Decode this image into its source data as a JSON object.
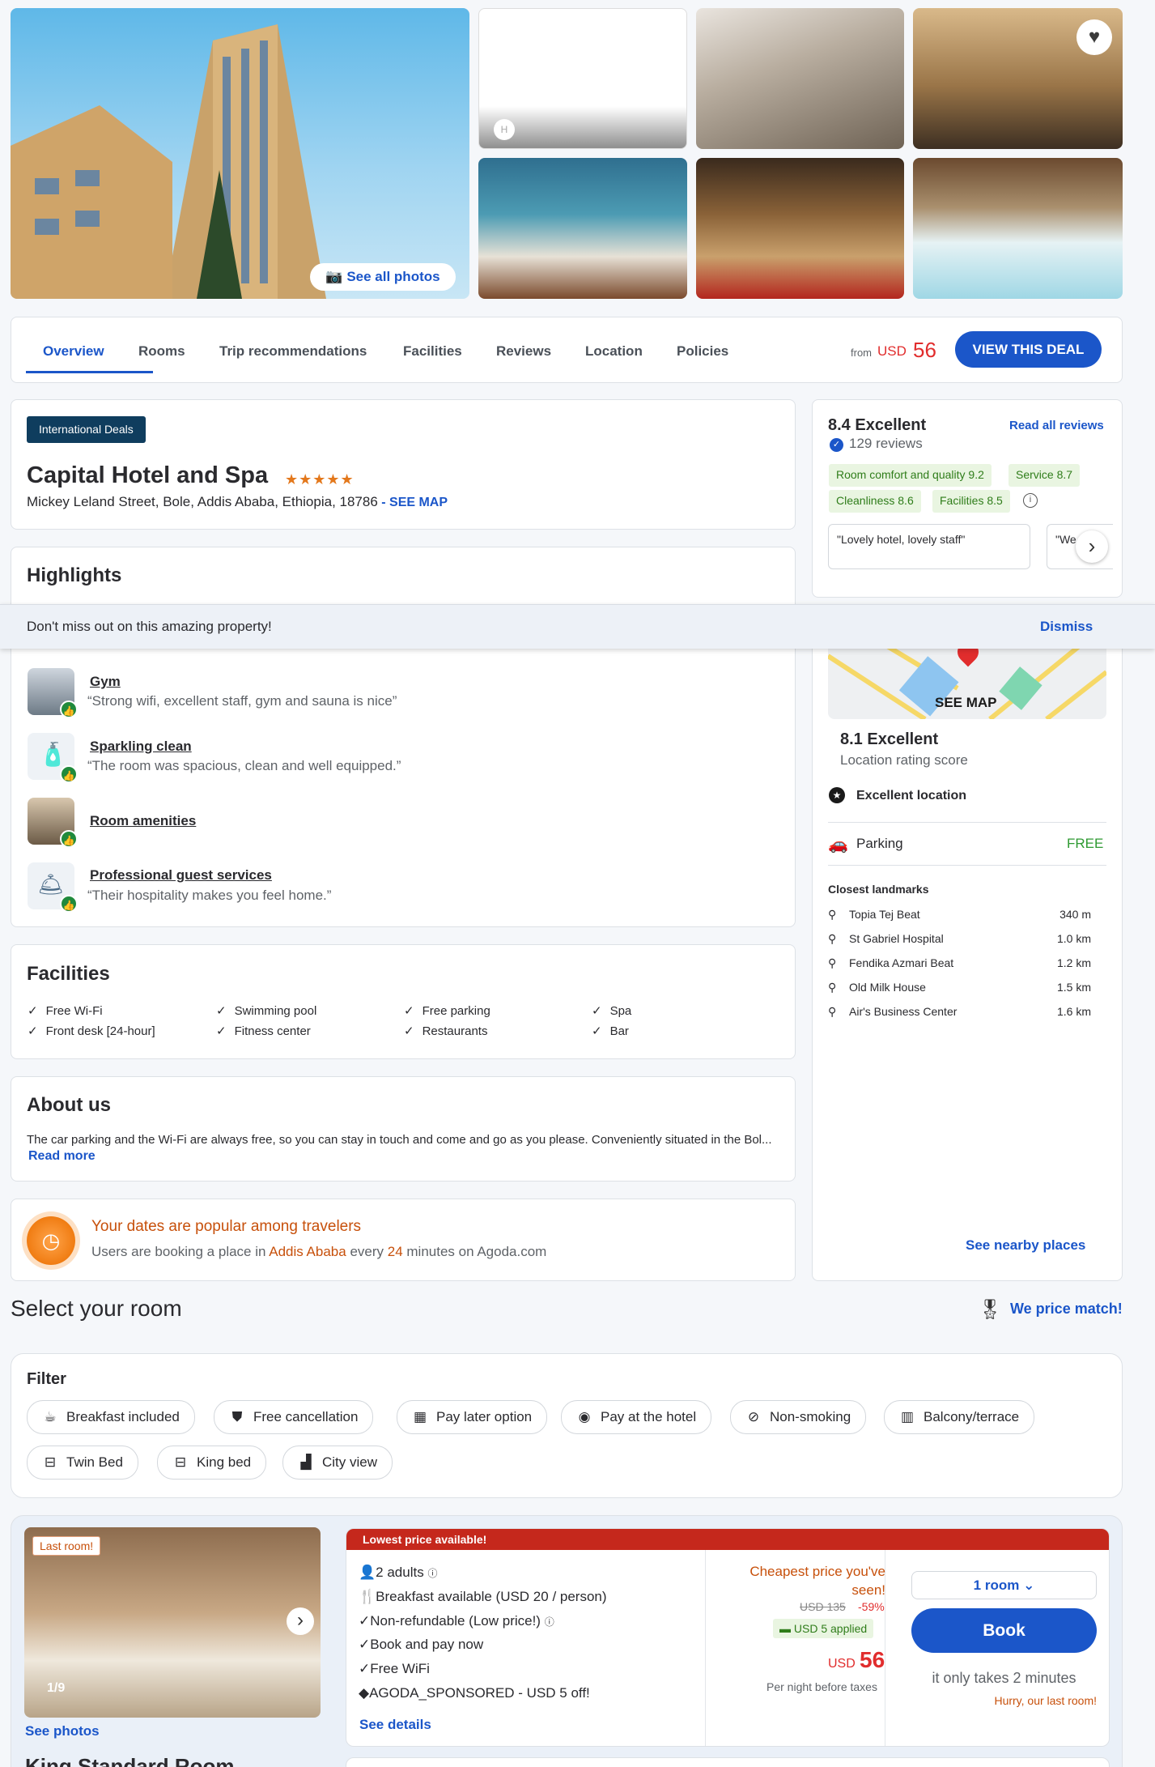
{
  "gallery": {
    "see_all_photos": "See all photos",
    "loading_badge": "H"
  },
  "nav": {
    "tabs": [
      "Overview",
      "Rooms",
      "Trip recommendations",
      "Facilities",
      "Reviews",
      "Location",
      "Policies"
    ],
    "from_label": "from",
    "currency": "USD",
    "price": "56",
    "cta": "VIEW THIS DEAL"
  },
  "hotel": {
    "badge": "International Deals",
    "name": "Capital Hotel and Spa",
    "stars": "★★★★★",
    "address": "Mickey Leland Street, Bole, Addis Ababa, Ethiopia, 18786",
    "see_map": " - SEE MAP"
  },
  "reviews": {
    "score": "8.4 Excellent",
    "count": "129 reviews",
    "read_all": "Read all reviews",
    "subscores": [
      "Room comfort and quality 9.2",
      "Service 8.7",
      "Cleanliness 8.6",
      "Facilities 8.5"
    ],
    "quote1": "\"Lovely hotel, lovely staff\"",
    "quote2": "\"We"
  },
  "highlights": {
    "title": "Highlights",
    "items": [
      {
        "title": "Gym",
        "quote": "“Strong wifi, excellent staff, gym and sauna is nice”"
      },
      {
        "title": "Sparkling clean",
        "quote": "“The room was spacious, clean and well equipped.”"
      },
      {
        "title": "Room amenities",
        "quote": ""
      },
      {
        "title": "Professional guest services",
        "quote": "“Their hospitality makes you feel home.”"
      }
    ]
  },
  "banner": {
    "text": "Don't miss out on this amazing property!",
    "dismiss": "Dismiss"
  },
  "location": {
    "see_map": "SEE MAP",
    "score": "8.1 Excellent",
    "score_label": "Location rating score",
    "excellent": "Excellent location",
    "parking": "Parking",
    "parking_value": "FREE",
    "landmarks_title": "Closest landmarks",
    "landmarks": [
      {
        "name": "Topia Tej Beat",
        "dist": "340 m",
        "icon": "⚲"
      },
      {
        "name": "St Gabriel Hospital",
        "dist": "1.0 km",
        "icon": "⚲"
      },
      {
        "name": "Fendika Azmari Beat",
        "dist": "1.2 km",
        "icon": "⚲"
      },
      {
        "name": "Old Milk House",
        "dist": "1.5 km",
        "icon": "⚲"
      },
      {
        "name": "Air's Business Center",
        "dist": "1.6 km",
        "icon": "⚲"
      }
    ],
    "nearby": "See nearby places"
  },
  "facilities": {
    "title": "Facilities",
    "items": [
      "Free Wi-Fi",
      "Swimming pool",
      "Free parking",
      "Spa",
      "Front desk [24-hour]",
      "Fitness center",
      "Restaurants",
      "Bar"
    ]
  },
  "about": {
    "title": "About us",
    "text": "The car parking and the Wi-Fi are always free, so you can stay in touch and come and go as you please. Conveniently situated in the Bol...",
    "read_more": "Read more"
  },
  "popular": {
    "title": "Your dates are popular among travelers",
    "pre": "Users are booking a place in ",
    "city": "Addis Ababa",
    "mid": " every ",
    "minutes": "24",
    "post": " minutes on Agoda.com"
  },
  "select": {
    "title": "Select your room",
    "price_match": "We price match!"
  },
  "filter": {
    "title": "Filter",
    "chips": [
      "Breakfast included",
      "Free cancellation",
      "Pay later option",
      "Pay at the hotel",
      "Non-smoking",
      "Balcony/terrace",
      "Twin Bed",
      "King bed",
      "City view"
    ]
  },
  "room": {
    "last_room": "Last room!",
    "counter": "1/9",
    "see_photos": "See photos",
    "name_partial": "King Standard Room",
    "banner": "Lowest price available!",
    "features": [
      "2 adults",
      "Breakfast available (USD 20 / person)",
      "Non-refundable (Low price!)",
      "Book and pay now",
      "Free WiFi",
      "AGODA_SPONSORED - USD 5 off!"
    ],
    "see_details": "See details",
    "cheapest": "Cheapest price you've seen!",
    "old_price": "USD 135",
    "discount": "-59%",
    "applied": "USD 5 applied",
    "currency": "USD",
    "price": "56",
    "per_night": "Per night before taxes",
    "rooms_select": "1 room",
    "book": "Book",
    "takes": "it only takes 2 minutes",
    "hurry": "Hurry, our last room!"
  }
}
